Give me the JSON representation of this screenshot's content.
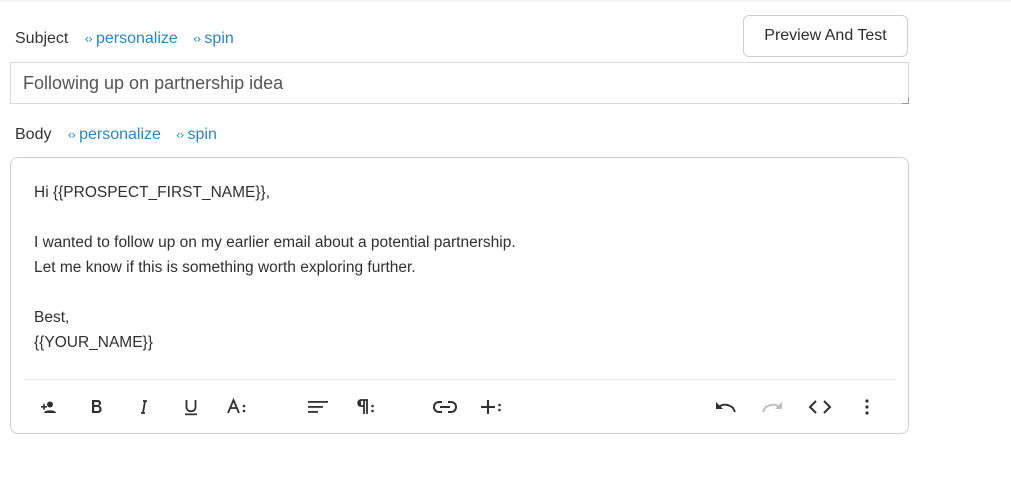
{
  "subject": {
    "label": "Subject",
    "personalize": "personalize",
    "spin": "spin",
    "value": "Following up on partnership idea"
  },
  "preview_button": "Preview And Test",
  "body": {
    "label": "Body",
    "personalize": "personalize",
    "spin": "spin",
    "lines": [
      "Hi {{PROSPECT_FIRST_NAME}},",
      "",
      "I wanted to follow up on my earlier email about a potential partnership.",
      "Let me know if this is something worth exploring further.",
      "",
      "Best,",
      "{{YOUR_NAME}}"
    ]
  },
  "toolbar": {
    "icons": [
      "add-person-icon",
      "bold-icon",
      "italic-icon",
      "underline-icon",
      "font-size-icon",
      "align-icon",
      "paragraph-icon",
      "link-icon",
      "insert-plus-icon",
      "undo-icon",
      "redo-icon",
      "code-view-icon",
      "more-icon"
    ]
  },
  "colors": {
    "link": "#2a86b8",
    "border": "#cfcfcf",
    "icon": "#2f2f2f",
    "disabled_icon": "#bdbdbd"
  }
}
